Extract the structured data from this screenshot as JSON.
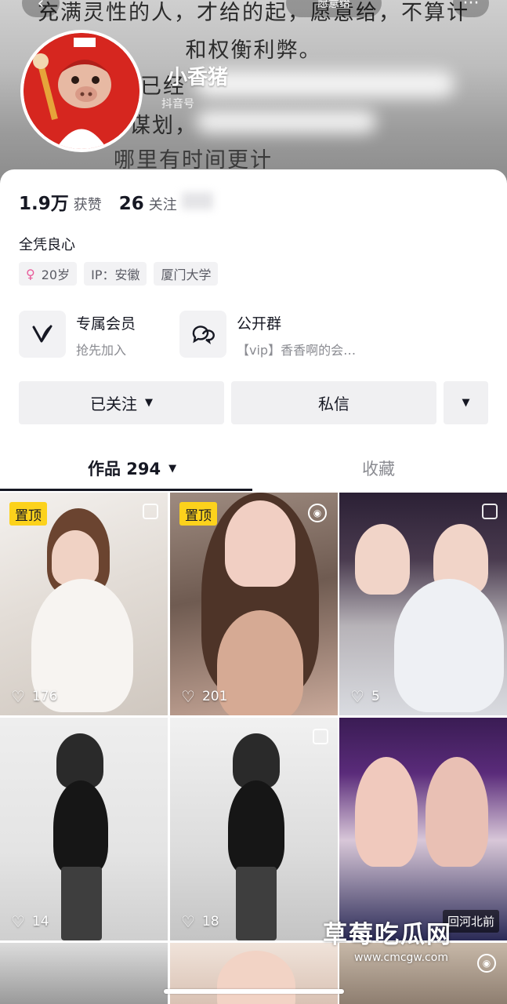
{
  "header": {
    "banner_lines": [
      "充满灵性的人，才给的起，愿意给，不算计",
      "和权衡利弊。",
      "情已经",
      "谋划，",
      "哪里有时间更计"
    ],
    "search_label": "愿意给",
    "back_icon": "chevron-left-icon",
    "more_icon": "more-icon",
    "nickname": "小香猪",
    "account_prefix": "抖音号"
  },
  "stats": {
    "likes_value": "1.9万",
    "likes_label": "获赞",
    "following_value": "26",
    "following_label": "关注"
  },
  "profile": {
    "bio": "全凭良心",
    "tags": {
      "age": "20岁",
      "ip": "IP：安徽",
      "school": "厦门大学"
    }
  },
  "features": [
    {
      "title": "专属会员",
      "subtitle": "抢先加入",
      "icon": "v-logo-icon"
    },
    {
      "title": "公开群",
      "subtitle": "【vip】香香啊的会…",
      "icon": "chat-bubbles-icon"
    }
  ],
  "actions": {
    "follow_label": "已关注",
    "message_label": "私信"
  },
  "tabs": {
    "works_label": "作品 294",
    "favorites_label": "收藏"
  },
  "videos": [
    {
      "likes": "176",
      "pinned": "置顶"
    },
    {
      "likes": "201",
      "pinned": "置顶"
    },
    {
      "likes": "5"
    },
    {
      "likes": "14"
    },
    {
      "likes": "18"
    },
    {
      "likes": "",
      "overlay": "回河北前"
    }
  ],
  "watermark": {
    "title": "草莓吃瓜网",
    "url": "www.cmcgw.com"
  },
  "colors": {
    "pin_badge": "#fcd21c",
    "text_primary": "#161823",
    "text_secondary": "#8a8b91"
  }
}
